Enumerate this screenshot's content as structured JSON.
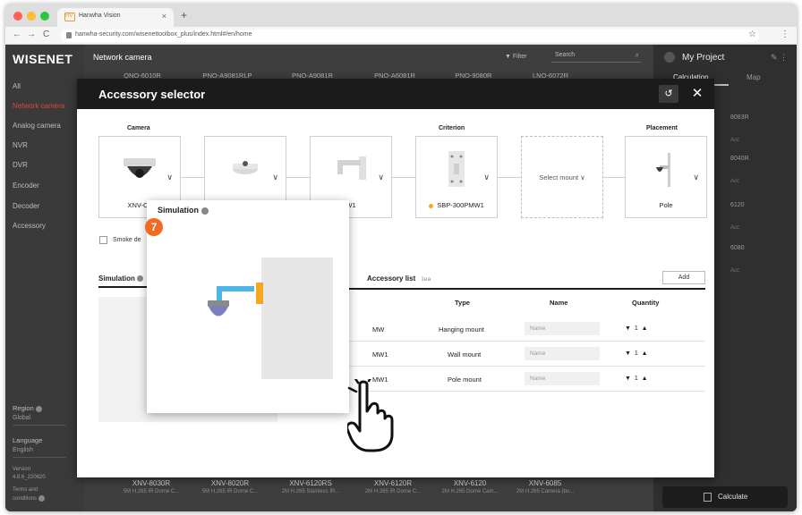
{
  "browser": {
    "tab_title": "Hanwha Vision",
    "tab_favicon_text": "HV",
    "tab_close": "×",
    "tab_new": "+",
    "url": "hanwha-security.com/wisenettoolbox_plus/index.html#/en/home",
    "nav_back": "←",
    "nav_forward": "→",
    "nav_reload": "C",
    "star": "☆",
    "menu": "⋮"
  },
  "app": {
    "logo": "WISENET",
    "sidebar": {
      "items": [
        {
          "label": "All"
        },
        {
          "label": "Network camera"
        },
        {
          "label": "Analog camera"
        },
        {
          "label": "NVR"
        },
        {
          "label": "DVR"
        },
        {
          "label": "Encoder"
        },
        {
          "label": "Decoder"
        },
        {
          "label": "Accessory"
        }
      ],
      "region_label": "Region",
      "region_value": "Global",
      "language_label": "Language",
      "language_value": "English",
      "version_label": "Version",
      "version_value": "4.8.6_220620",
      "terms_label": "Terms and",
      "terms_label2": "conditions"
    },
    "main": {
      "title": "Network camera",
      "filter_label": "Filter",
      "search_placeholder": "Search",
      "top_models": [
        "QNO-6010R",
        "PNO-A9081RLP",
        "PNO-A9081R",
        "PNO-A6081R",
        "PNO-9080R",
        "LNO-6072R"
      ],
      "bottom_models": [
        {
          "name": "XNV-8030R",
          "desc": "5M H.265 IR Dome C..."
        },
        {
          "name": "XNV-8020R",
          "desc": "5M H.265 IR Dome C..."
        },
        {
          "name": "XNV-6120RS",
          "desc": "2M H.265 Stainless IR..."
        },
        {
          "name": "XNV-6120R",
          "desc": "2M H.265 IR Dome C..."
        },
        {
          "name": "XNV-6120",
          "desc": "2M H.265 Dome Cam..."
        },
        {
          "name": "XNV-6085",
          "desc": "2M H.265 Camera (bu..."
        }
      ]
    },
    "right_panel": {
      "title": "My Project",
      "tab_calculation": "Calculation",
      "tab_map": "Map",
      "codes": [
        "8083R",
        "8040R",
        "6120",
        "6080"
      ],
      "acc_label": "Acc",
      "calculate_label": "Calculate"
    }
  },
  "modal": {
    "title": "Accessory selector",
    "reset_icon": "↺",
    "close_icon": "✕",
    "camera_label": "Camera",
    "criterion_label": "Criterion",
    "placement_label": "Placement",
    "cards": [
      {
        "name": "XNV-C6",
        "chevron": "∨"
      },
      {
        "name": "",
        "chevron": "∨"
      },
      {
        "name": "W1",
        "chevron": "∨"
      },
      {
        "name": "SBP-300PMW1",
        "chevron": "∨"
      },
      {
        "name": "Select mount",
        "chevron": "∨"
      },
      {
        "name": "Pole",
        "chevron": "∨"
      }
    ],
    "smoke_label": "Smoke de",
    "simulation_label": "Simulation",
    "accessory_list_label": "Accessory list",
    "accessory_count": "1ea",
    "add_label": "Add",
    "table_headers": {
      "type": "Type",
      "name": "Name",
      "quantity": "Quantity"
    },
    "rows": [
      {
        "model": "MW",
        "type": "Hanging mount",
        "name_placeholder": "Name",
        "qty": "1"
      },
      {
        "model": "MW1",
        "type": "Wall mount",
        "name_placeholder": "Name",
        "qty": "1"
      },
      {
        "model": "MW1",
        "type": "Pole mount",
        "name_placeholder": "Name",
        "qty": "1"
      }
    ],
    "qty_down": "▼",
    "qty_up": "▲"
  },
  "popup": {
    "title": "Simulation",
    "step": "7"
  },
  "colors": {
    "accent": "#e1473d",
    "step_badge": "#f26a21",
    "mount_orange": "#f5a623",
    "mount_blue": "#4db6e6",
    "dome_purple": "#7b7fc2"
  }
}
